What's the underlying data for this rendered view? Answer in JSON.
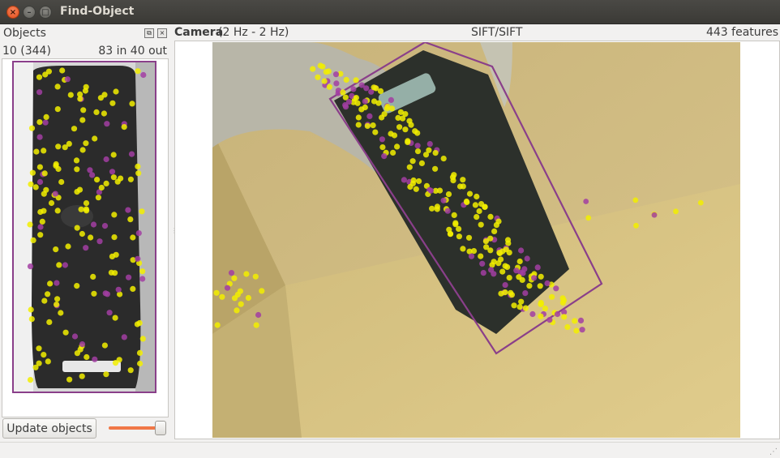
{
  "window": {
    "title": "Find-Object",
    "close_glyph": "×",
    "min_glyph": "–",
    "max_glyph": "□"
  },
  "objects_panel": {
    "title": "Objects",
    "float_glyph": "⧉",
    "close_glyph": "×",
    "object_label": "10 (344)",
    "match_stats": "83 in 40 out",
    "update_button_label": "Update objects",
    "threshold_slider": {
      "value_fraction": 0.95
    }
  },
  "camera_panel": {
    "title": "Camera",
    "rate": "(2 Hz - 2 Hz)",
    "algorithm": "SIFT/SIFT",
    "features": "443 features"
  },
  "colors": {
    "keypoint_matched": "#f2ee00",
    "keypoint_unmatched": "#a23ea2",
    "homography_outline": "#8a3f8a",
    "accent": "#f07746"
  },
  "icons": {
    "close": "close-icon",
    "minimize": "minimize-icon",
    "maximize": "maximize-icon",
    "float": "float-icon",
    "dock_close": "dock-close-icon",
    "splitter": "splitter-grip-icon",
    "size_grip": "size-grip-icon"
  }
}
